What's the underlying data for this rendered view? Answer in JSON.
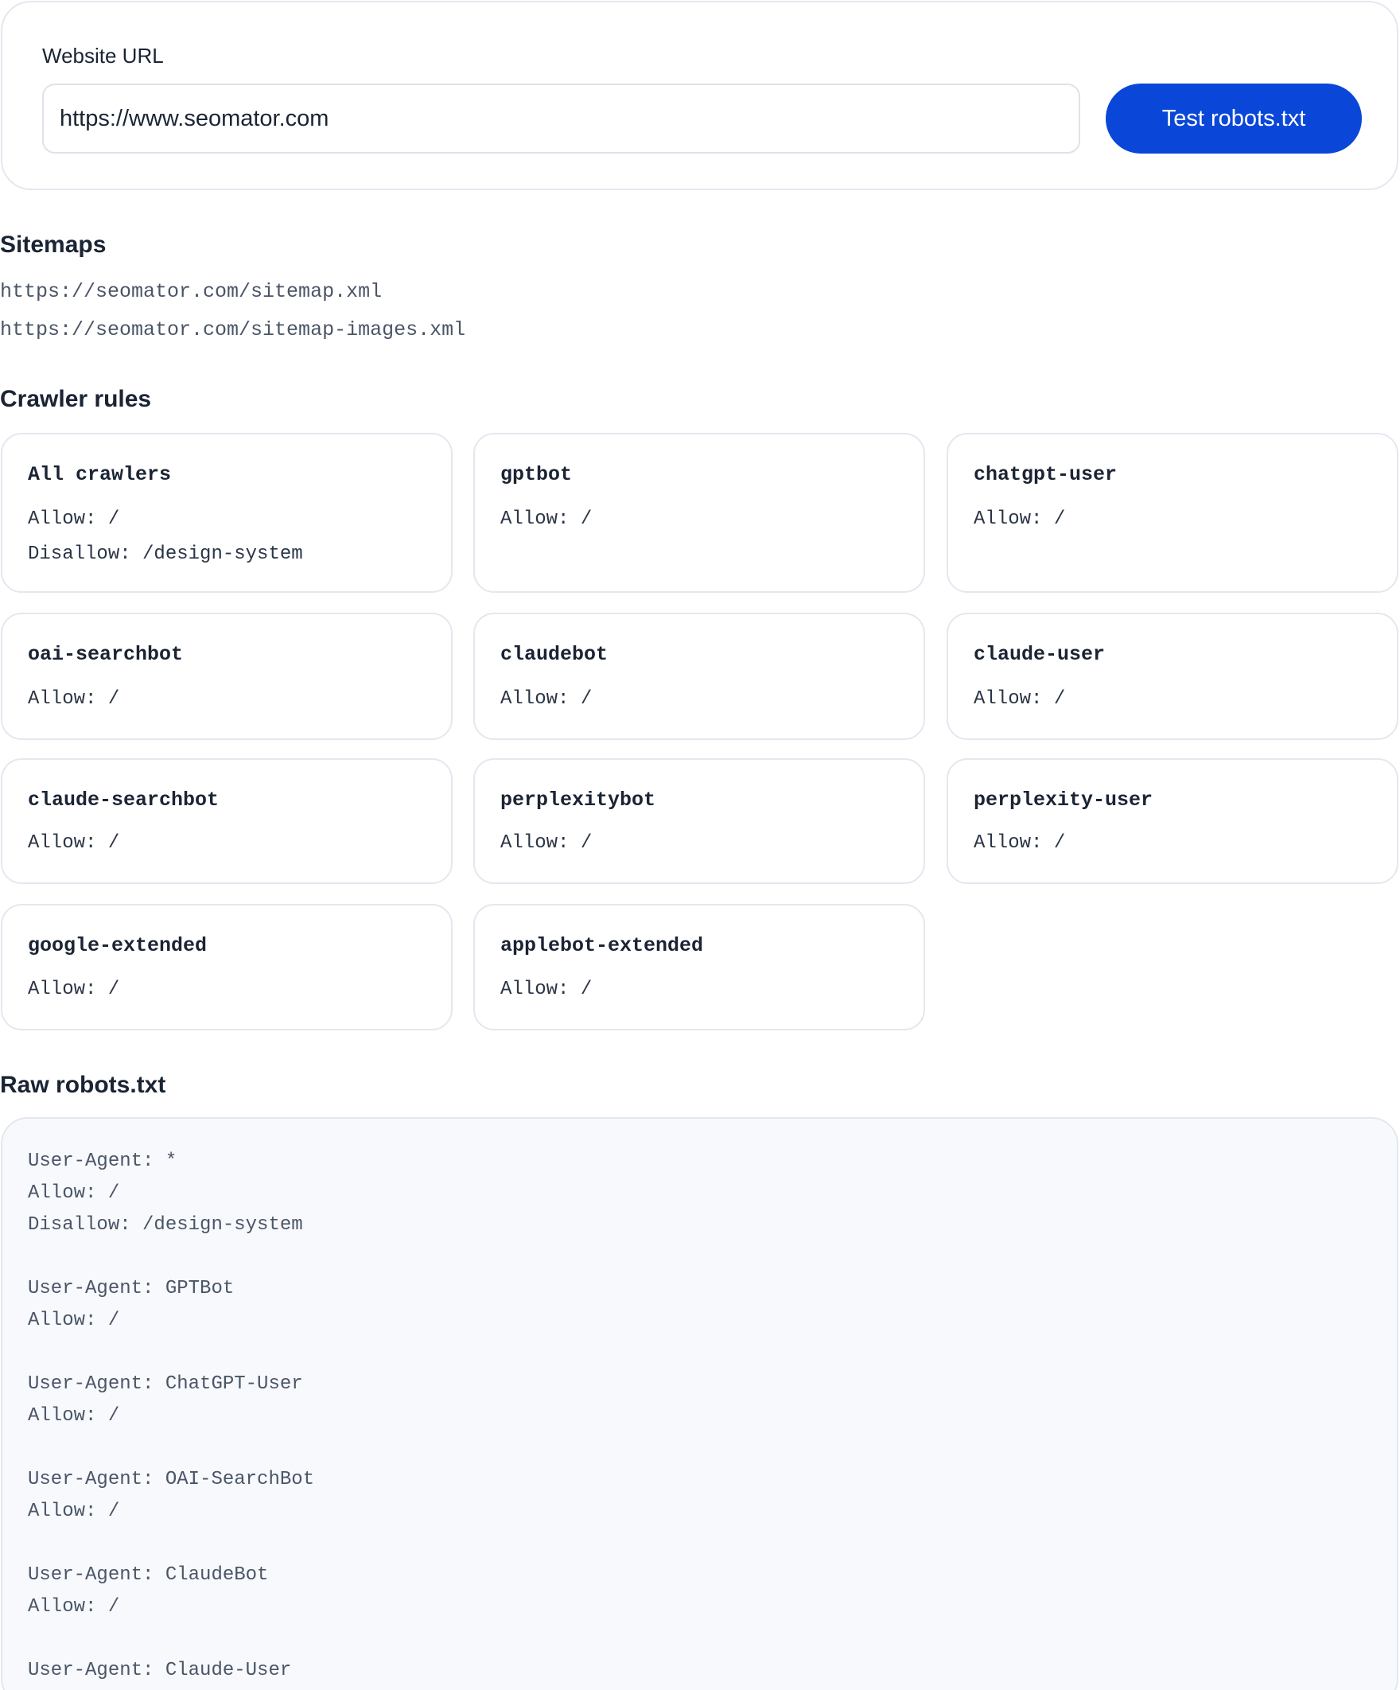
{
  "url_form": {
    "label": "Website URL",
    "value": "https://www.seomator.com",
    "button_label": "Test robots.txt"
  },
  "sitemaps": {
    "title": "Sitemaps",
    "items": [
      "https://seomator.com/sitemap.xml",
      "https://seomator.com/sitemap-images.xml"
    ]
  },
  "crawler_rules": {
    "title": "Crawler rules",
    "items": [
      {
        "name": "All crawlers",
        "lines": [
          "Allow: /",
          "Disallow: /design-system"
        ]
      },
      {
        "name": "gptbot",
        "lines": [
          "Allow: /"
        ]
      },
      {
        "name": "chatgpt-user",
        "lines": [
          "Allow: /"
        ]
      },
      {
        "name": "oai-searchbot",
        "lines": [
          "Allow: /"
        ]
      },
      {
        "name": "claudebot",
        "lines": [
          "Allow: /"
        ]
      },
      {
        "name": "claude-user",
        "lines": [
          "Allow: /"
        ]
      },
      {
        "name": "claude-searchbot",
        "lines": [
          "Allow: /"
        ]
      },
      {
        "name": "perplexitybot",
        "lines": [
          "Allow: /"
        ]
      },
      {
        "name": "perplexity-user",
        "lines": [
          "Allow: /"
        ]
      },
      {
        "name": "google-extended",
        "lines": [
          "Allow: /"
        ]
      },
      {
        "name": "applebot-extended",
        "lines": [
          "Allow: /"
        ]
      }
    ]
  },
  "raw_robots": {
    "title": "Raw robots.txt",
    "content": "User-Agent: *\nAllow: /\nDisallow: /design-system\n\nUser-Agent: GPTBot\nAllow: /\n\nUser-Agent: ChatGPT-User\nAllow: /\n\nUser-Agent: OAI-SearchBot\nAllow: /\n\nUser-Agent: ClaudeBot\nAllow: /\n\nUser-Agent: Claude-User"
  },
  "colors": {
    "accent": "#0a47d9",
    "border": "#e3e8ef",
    "raw_background": "#f7f9fd"
  }
}
